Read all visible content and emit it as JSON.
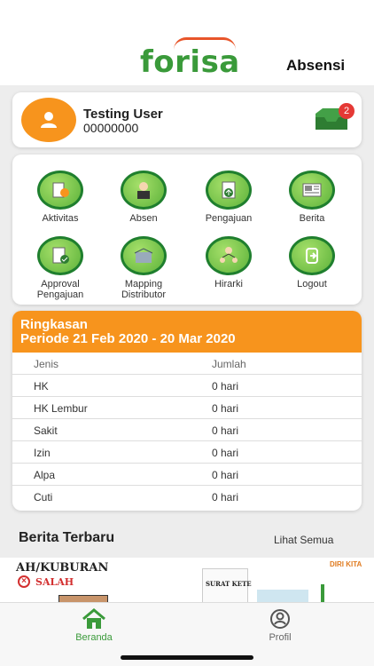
{
  "header": {
    "brand": "forisa",
    "title": "Absensi"
  },
  "profile": {
    "name": "Testing User",
    "id": "00000000",
    "notification_count": "2"
  },
  "menu": [
    {
      "label": "Aktivitas",
      "icon": "activity-icon"
    },
    {
      "label": "Absen",
      "icon": "attendance-icon"
    },
    {
      "label": "Pengajuan",
      "icon": "submission-icon"
    },
    {
      "label": "Berita",
      "icon": "news-icon"
    },
    {
      "label": "Approval Pengajuan",
      "icon": "approval-icon"
    },
    {
      "label": "Mapping Distributor",
      "icon": "distributor-icon"
    },
    {
      "label": "Hirarki",
      "icon": "hierarchy-icon"
    },
    {
      "label": "Logout",
      "icon": "logout-icon"
    }
  ],
  "summary": {
    "title": "Ringkasan",
    "period": "Periode 21 Feb 2020 - 20 Mar 2020",
    "columns": [
      "Jenis",
      "Jumlah"
    ],
    "rows": [
      [
        "HK",
        "0 hari"
      ],
      [
        "HK Lembur",
        "0 hari"
      ],
      [
        "Sakit",
        "0 hari"
      ],
      [
        "Izin",
        "0 hari"
      ],
      [
        "Alpa",
        "0 hari"
      ],
      [
        "Cuti",
        "0 hari"
      ]
    ]
  },
  "news": {
    "title": "Berita Terbaru",
    "see_all": "Lihat Semua",
    "thumb1_text": "AH/KUBURAN",
    "thumb1_sub": "SALAH",
    "thumb2_text": "SURAT KETE",
    "thumb3_text": "DIRI KITA"
  },
  "nav": {
    "home": "Beranda",
    "profile": "Profil"
  },
  "colors": {
    "green": "#3a9a3a",
    "orange": "#f7941d",
    "badge": "#e53935"
  }
}
